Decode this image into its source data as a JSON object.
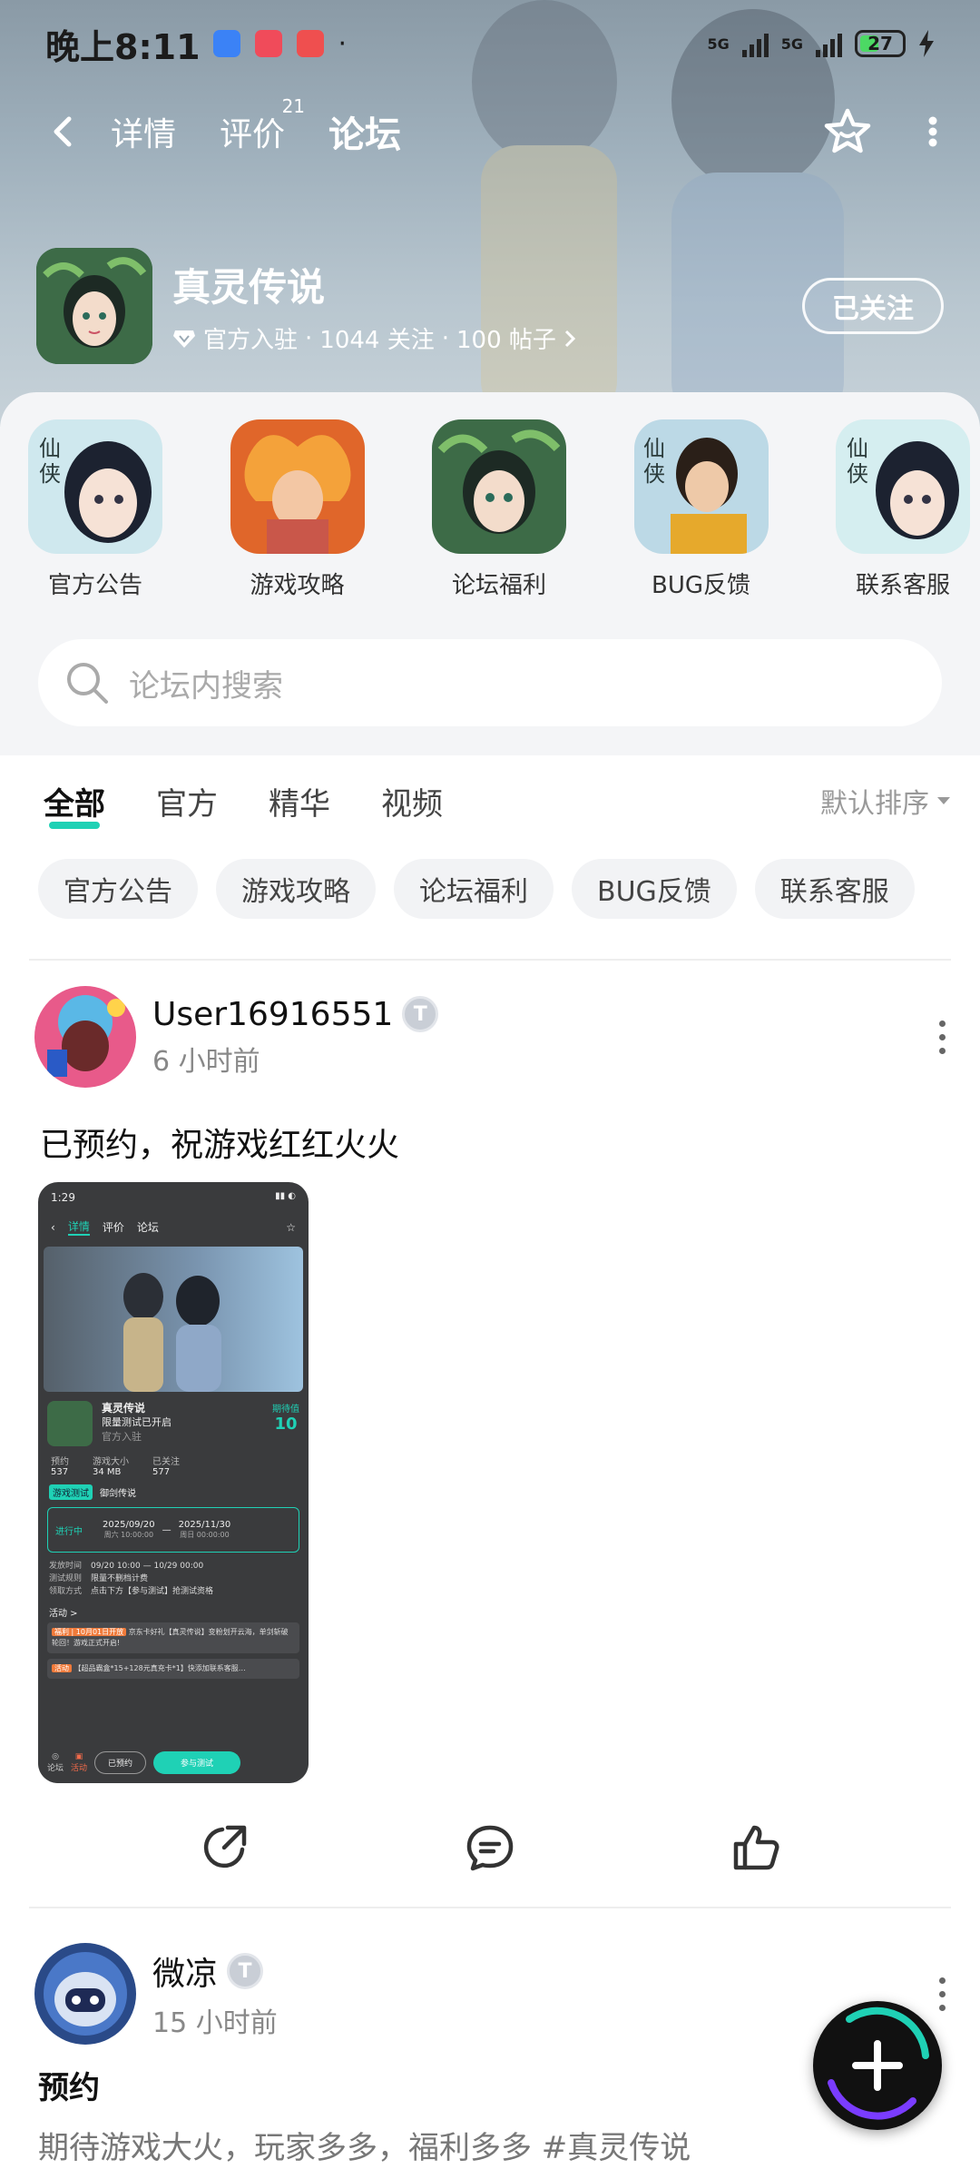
{
  "status_bar": {
    "time": "晚上8:11",
    "network": "5G",
    "network2": "5G",
    "battery": "27"
  },
  "header": {
    "tabs": [
      {
        "label": "详情"
      },
      {
        "label": "评价",
        "badge": "21"
      },
      {
        "label": "论坛"
      }
    ],
    "active_tab": "论坛"
  },
  "game": {
    "title": "真灵传说",
    "official": "官方入驻",
    "follows": "1044 关注",
    "posts": "100 帖子",
    "sep": "·",
    "follow_button": "已关注"
  },
  "categories": [
    {
      "label": "官方公告"
    },
    {
      "label": "游戏攻略"
    },
    {
      "label": "论坛福利"
    },
    {
      "label": "BUG反馈"
    },
    {
      "label": "联系客服"
    }
  ],
  "search": {
    "placeholder": "论坛内搜索"
  },
  "feed_tabs": [
    {
      "label": "全部"
    },
    {
      "label": "官方"
    },
    {
      "label": "精华"
    },
    {
      "label": "视频"
    }
  ],
  "sort_label": "默认排序",
  "chips": [
    {
      "label": "官方公告"
    },
    {
      "label": "游戏攻略"
    },
    {
      "label": "论坛福利"
    },
    {
      "label": "BUG反馈"
    },
    {
      "label": "联系客服"
    }
  ],
  "posts": [
    {
      "user": "User16916551",
      "level": "T",
      "time": "6 小时前",
      "text": "已预约，祝游戏红红火火",
      "screenshot": {
        "time": "1:29",
        "tabs": [
          "详情",
          "评价",
          "论坛"
        ],
        "game_title": "真灵传说",
        "game_sub": "限量测试已开启",
        "official": "官方入驻",
        "score_label": "期待值",
        "score": "10",
        "stats": [
          {
            "label": "预约",
            "value": "537"
          },
          {
            "label": "游戏大小",
            "value": "34 MB"
          },
          {
            "label": "已关注",
            "value": "577"
          }
        ],
        "test_tag": "游戏测试",
        "test_name": "御剑传说",
        "status": "进行中",
        "date_start": "2025/09/20",
        "date_start_sub": "周六 10:00:00",
        "date_end": "2025/11/30",
        "date_end_sub": "周日 00:00:00",
        "rows": [
          {
            "k": "发放时间",
            "v": "09/20 10:00 — 10/29 00:00"
          },
          {
            "k": "测试规则",
            "v": "限量不删档计费"
          },
          {
            "k": "领取方式",
            "v": "点击下方【参与测试】抢测试资格"
          }
        ],
        "activity_label": "活动 >",
        "activities": [
          {
            "tag": "福利 | 10月01日开放",
            "text": "京东卡好礼【真灵传说】变粉划开云海，单剑斩破轮回！游戏正式开启!"
          },
          {
            "tag": "活动",
            "text": "【超品霸盒*15+128元真充卡*1】快添加联系客服…"
          }
        ],
        "bottom_reserved": "已预约",
        "bottom_join": "参与测试",
        "bottom_forum": "论坛",
        "bottom_activity": "活动"
      }
    },
    {
      "user": "微凉",
      "level": "T",
      "time": "15 小时前",
      "title": "预约",
      "text": "期待游戏大火，玩家多多，福利多多 #真灵传说"
    }
  ],
  "colors": {
    "accent": "#1fd1b5"
  }
}
